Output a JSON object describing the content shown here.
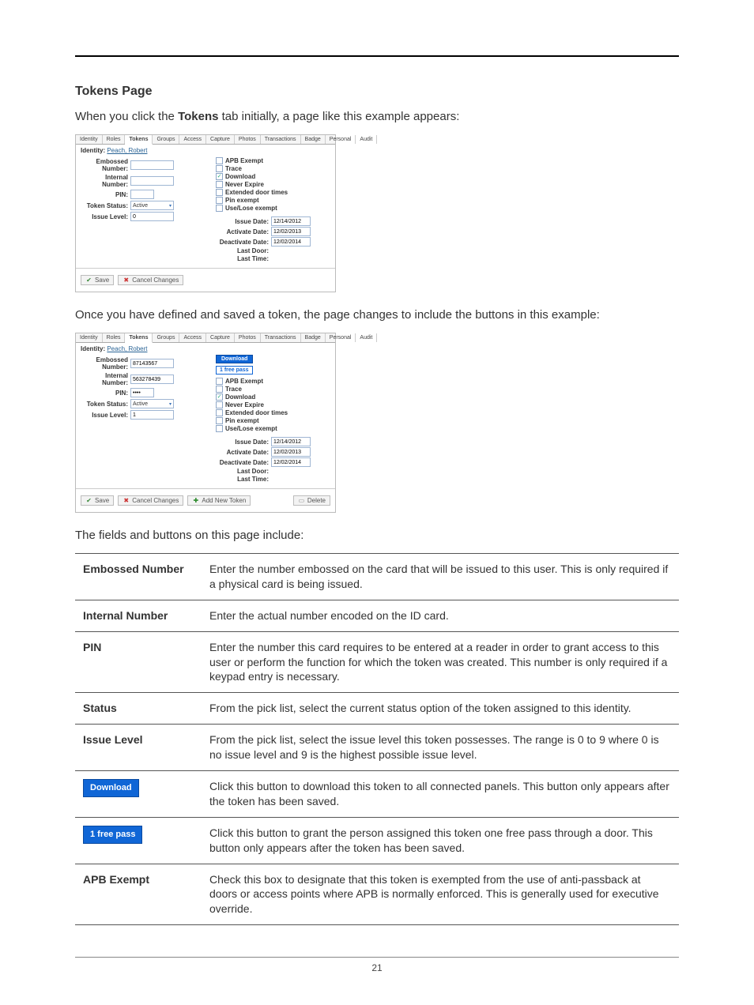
{
  "page_number": "21",
  "heading": "Tokens Page",
  "intro_para_prefix": "When you click the ",
  "intro_para_bold": "Tokens",
  "intro_para_suffix": " tab initially, a page like this example appears:",
  "mid_para": "Once you have defined and saved a token, the page changes to include the buttons in this example:",
  "fields_intro": "The fields and buttons on this page include:",
  "tabs": [
    "Identity",
    "Roles",
    "Tokens",
    "Groups",
    "Access",
    "Capture",
    "Photos",
    "Transactions",
    "Badge",
    "Personal",
    "Audit"
  ],
  "identity_label": "Identity:",
  "identity_name": "Peach, Robert",
  "form_labels": {
    "embossed": "Embossed Number:",
    "internal": "Internal Number:",
    "pin": "PIN:",
    "status": "Token Status:",
    "issue": "Issue Level:"
  },
  "form_values_a": {
    "embossed": "",
    "internal": "",
    "pin": "",
    "status": "Active",
    "issue": "0"
  },
  "form_values_b": {
    "embossed": "87143567",
    "internal": "563278439",
    "pin": "••••",
    "status": "Active",
    "issue": "1"
  },
  "download_btn": "Download",
  "free_pass_btn": "1 free pass",
  "checkboxes": [
    {
      "label": "APB Exempt",
      "checked": false
    },
    {
      "label": "Trace",
      "checked": false
    },
    {
      "label": "Download",
      "checked": true
    },
    {
      "label": "Never Expire",
      "checked": false
    },
    {
      "label": "Extended door times",
      "checked": false
    },
    {
      "label": "Pin exempt",
      "checked": false
    },
    {
      "label": "Use/Lose exempt",
      "checked": false
    }
  ],
  "date_labels": {
    "issue": "Issue Date:",
    "activate": "Activate Date:",
    "deactivate": "Deactivate Date:",
    "lastdoor": "Last Door:",
    "lasttime": "Last Time:"
  },
  "date_values_a": {
    "issue": "12/14/2012",
    "activate": "12/02/2013",
    "deactivate": "12/02/2014"
  },
  "date_values_b": {
    "issue": "12/14/2012",
    "activate": "12/02/2013",
    "deactivate": "12/02/2014"
  },
  "toolbar": {
    "save": "Save",
    "cancel": "Cancel Changes",
    "addnew": "Add New Token",
    "delete": "Delete"
  },
  "def_rows": [
    {
      "term": "Embossed Number",
      "desc": "Enter the number embossed on the card that will be issued to this user. This is only required if a physical card is being issued."
    },
    {
      "term": "Internal Number",
      "desc": "Enter the actual number encoded on the ID card."
    },
    {
      "term": "PIN",
      "desc": "Enter the number this card requires to be entered at a reader in order to grant access to this user or perform the function for which the token was created. This number is only required if a keypad entry is necessary."
    },
    {
      "term": "Status",
      "desc": "From the pick list, select the current status option of the token assigned to this identity."
    },
    {
      "term": "Issue Level",
      "desc": "From the pick list, select the issue level this token possesses. The range is 0 to 9 where 0 is no issue level and 9 is the highest possible issue level."
    },
    {
      "term": "__download_btn__",
      "desc": "Click this button to download this token to all connected panels. This button only appears after the token has been saved."
    },
    {
      "term": "__freepass_btn__",
      "desc": "Click this button to grant the person assigned this token one free pass through a door. This button only appears after the token has been saved."
    },
    {
      "term": "APB Exempt",
      "desc": "Check this box to designate that this token is exempted from the use of anti-passback at doors or access points where APB is normally enforced. This is generally used for executive override."
    }
  ]
}
